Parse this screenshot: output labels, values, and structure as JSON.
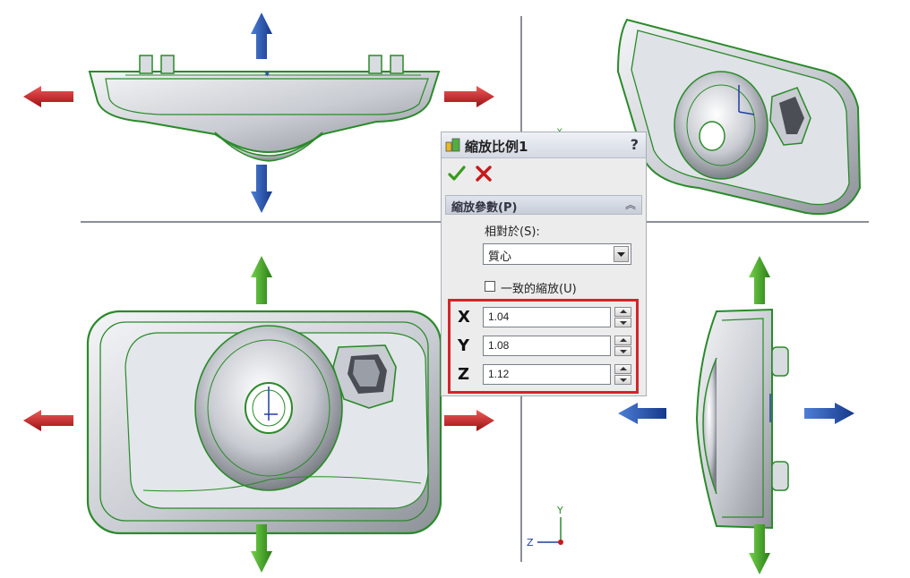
{
  "dialog": {
    "title": "縮放比例1",
    "help": "?",
    "feature_icon": "scale-feature-icon",
    "ok_icon": "check-icon",
    "cancel_icon": "close-icon",
    "section": {
      "title": "縮放參數(P)",
      "collapse_icon": "double-chevron-up-icon",
      "relative_label": "相對於(S):",
      "relative_value": "質心",
      "uniform_label": "一致的縮放(U)",
      "uniform_checked": false,
      "x_label": "X",
      "x_value": "1.04",
      "y_label": "Y",
      "y_value": "1.08",
      "z_label": "Z",
      "z_value": "1.12"
    },
    "highlight_color": "#d6232a"
  },
  "viewport": {
    "triad_axes": [
      "Y",
      "Z"
    ],
    "axis_marker": "Y",
    "arrow_colors": {
      "x": "#c8181c",
      "y": "#3a9a1e",
      "z": "#1f4fa8"
    },
    "edge_color": "#2a8a2a"
  }
}
